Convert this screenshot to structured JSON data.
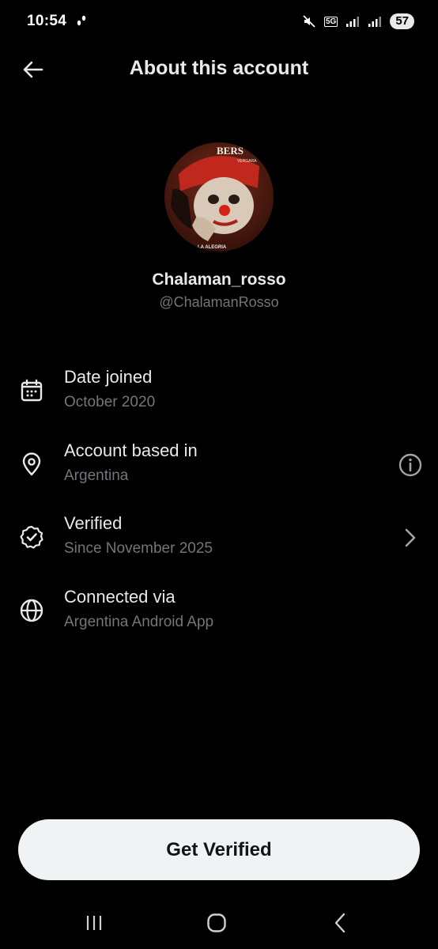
{
  "status_bar": {
    "time": "10:54",
    "network": "5G",
    "battery": "57"
  },
  "header": {
    "title": "About this account"
  },
  "profile": {
    "display_name": "Chalaman_rosso",
    "handle": "@ChalamanRosso",
    "avatar_text_top": "BERS",
    "avatar_text_sub": "VERGARA",
    "avatar_text_bottom": "LA ALEGRIA"
  },
  "rows": [
    {
      "title": "Date joined",
      "subtitle": "October 2020",
      "icon": "calendar-icon"
    },
    {
      "title": "Account based in",
      "subtitle": "Argentina",
      "icon": "location-pin-icon",
      "action_icon": "info-icon"
    },
    {
      "title": "Verified",
      "subtitle": "Since November 2025",
      "icon": "verified-badge-icon",
      "action_icon": "chevron-right-icon"
    },
    {
      "title": "Connected via",
      "subtitle": "Argentina Android App",
      "icon": "globe-icon"
    }
  ],
  "button": {
    "label": "Get Verified"
  },
  "colors": {
    "background": "#000000",
    "primary_text": "#e7e9ea",
    "secondary_text": "#71767b",
    "button_bg": "#eff3f4"
  }
}
